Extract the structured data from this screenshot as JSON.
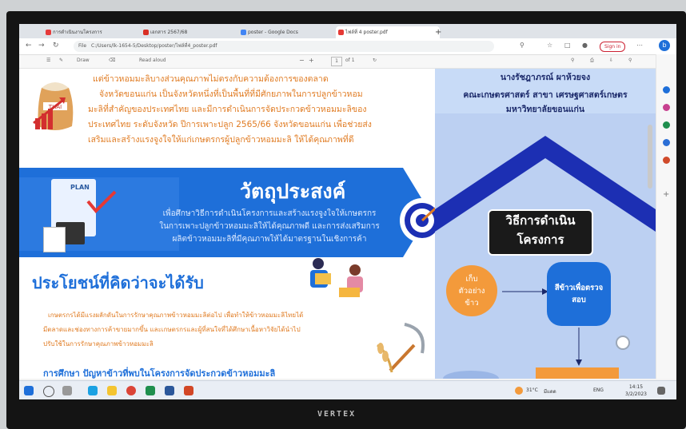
{
  "browser": {
    "tabs": [
      {
        "label": "การดำเนินงานโครงการ",
        "color": "#e63b3b"
      },
      {
        "label": "เอกสาร 2567/68",
        "color": "#d93025"
      },
      {
        "label": "poster - Google Docs",
        "color": "#4285f4"
      },
      {
        "label": "ไฟล์ที่ 4 poster.pdf",
        "color": "#e53935"
      }
    ],
    "new_tab_label": "+",
    "address": "C:/Users/lk-1654-5/Desktop/poster/ไฟล์ที่4_poster.pdf",
    "address_prefix": "File",
    "signin_label": "Sign in",
    "toolbar": {
      "draw_label": "Draw",
      "read_aloud_label": "Read aloud",
      "page_current": "1",
      "page_total": "of 1"
    }
  },
  "poster": {
    "intro_lines": [
      "แต่ข้าวหอมมะลิบางส่วนคุณภาพไม่ตรงกับความต้องการของตลาด",
      "จังหวัดขอนแก่น เป็นจังหวัดหนึ่งที่เป็นพื้นที่ที่มีศักยภาพในการปลูกข้าวหอม",
      "มะลิที่สำคัญของประเทศไทย และมีการดำเนินการจัดประกวดข้าวหอมมะลิของ",
      "ประเทศไทย ระดับจังหวัด ปีการเพาะปลูก 2565/66 จังหวัดขอนแก่น เพื่อช่วยส่ง",
      "เสริมและสร้างแรงจูงใจให้แก่เกษตรกรผู้ปลูกข้าวหอมมะลิ ให้ได้คุณภาพที่ดี"
    ],
    "objective": {
      "heading": "วัตถุประสงค์",
      "lines": [
        "เพื่อศึกษาวิธีการดำเนินโครงการและสร้างแรงจูงใจให้เกษตรกร",
        "ในการเพาะปลูกข้าวหอมมะลิให้ได้คุณภาพดี และการส่งเสริมการ",
        "ผลิตข้าวหอมมะลิที่มีคุณภาพให้ได้มาตรฐานในเชิงการค้า"
      ],
      "plan_label": "PLAN"
    },
    "benefit": {
      "heading": "ประโยชน์ที่คิดว่าจะได้รับ",
      "lines": [
        "เกษตรกรได้มีแรงผลักดันในการรักษาคุณภาพข้าวหอมมะลิต่อไป เพื่อทำให้ข้าวหอมมะลิไทยได้",
        "มีตลาดและช่องทางการค้าขายมากขึ้น และเกษตรกรและผู้ที่สนใจที่ได้ศึกษาเนื้อหาวิจัยได้นำไป",
        "ปรับใช้ในการรักษาคุณภาพข้าวหอมมะลิ"
      ]
    },
    "study_heading": "การศึกษา ปัญหาข้าวที่พบในโครงการจัดประกวดข้าวหอมมะลิ",
    "author": {
      "name": "นางรัชฎาภรณ์ ผาห้วยจง",
      "faculty": "คณะเกษตรศาสตร์ สาขา เศรษฐศาสตร์เกษตร",
      "university": "มหาวิทยาลัยขอนแก่น"
    },
    "method": {
      "heading_line1": "วิธีการดำเนิน",
      "heading_line2": "โครงการ",
      "step1": [
        "เก็บ",
        "ตัวอย่าง",
        "ข้าว"
      ],
      "step2": [
        "สีข้าวเพื่อตรวจ",
        "สอบ"
      ]
    },
    "sack_label": "THAI"
  },
  "taskbar": {
    "weather": "31°C",
    "weather_text": "มีแดด",
    "language": "ENG",
    "time": "14:15",
    "date": "3/2/2023"
  },
  "monitor": {
    "brand": "VERTEX"
  },
  "colors": {
    "orange": "#e07b22",
    "blue": "#1e6fd9",
    "navy": "#1c2fb3",
    "panel": "#bcd0f2"
  }
}
